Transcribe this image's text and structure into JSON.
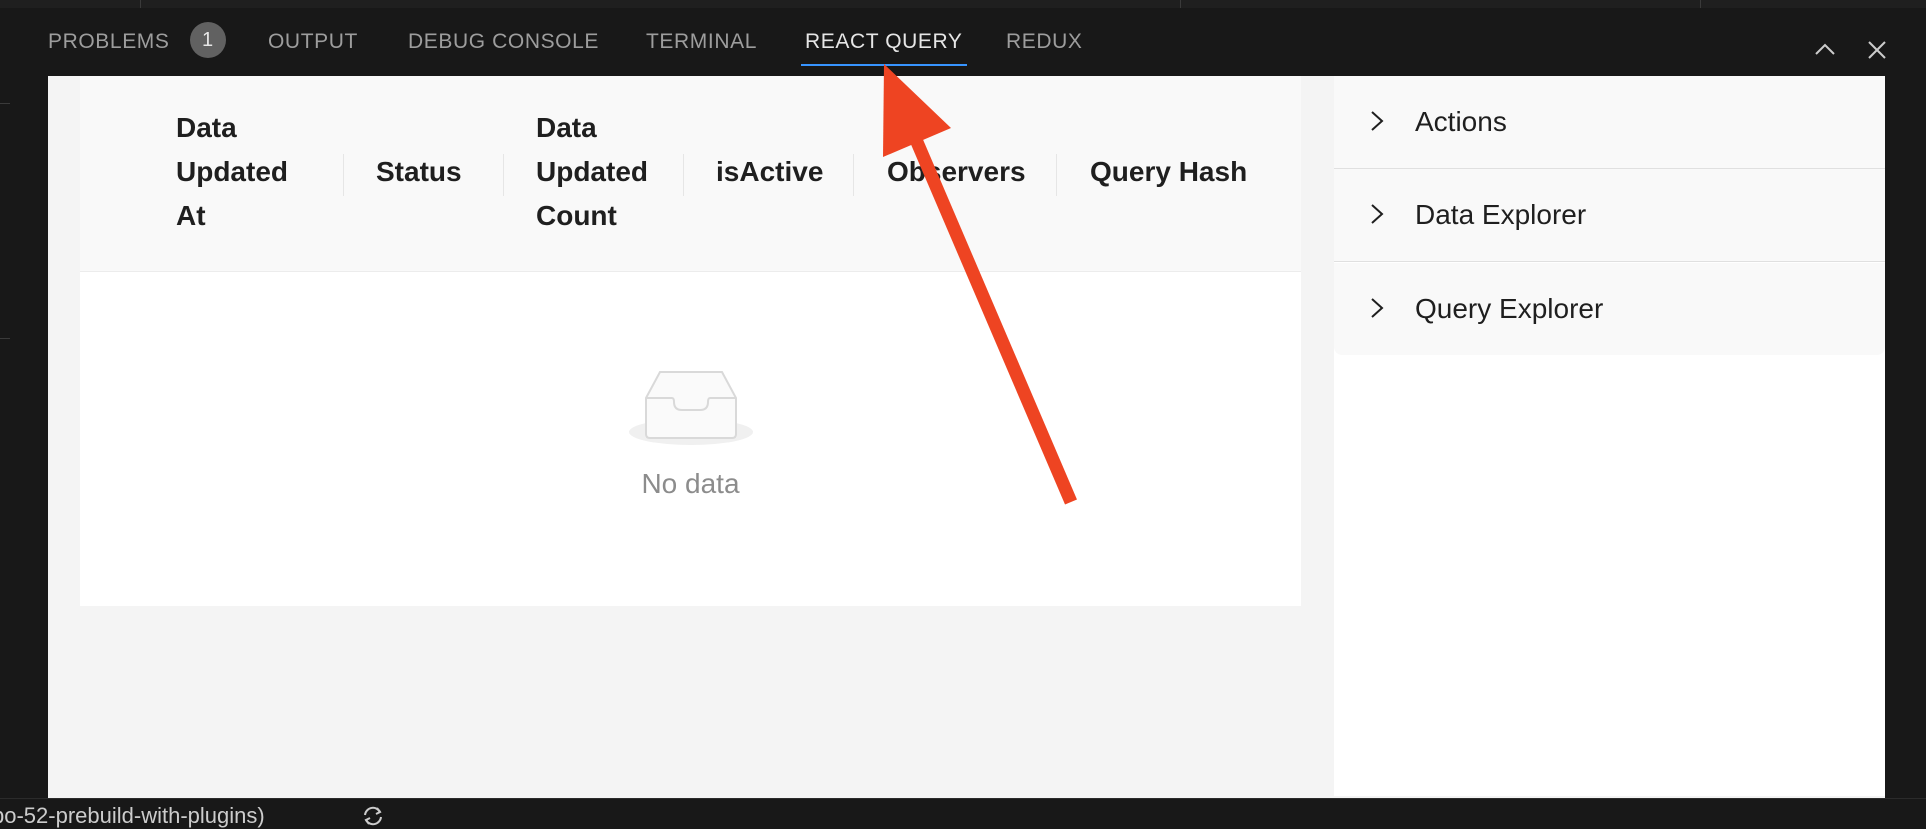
{
  "panel": {
    "tabs": [
      {
        "label": "PROBLEMS",
        "badge": "1"
      },
      {
        "label": "OUTPUT"
      },
      {
        "label": "DEBUG CONSOLE"
      },
      {
        "label": "TERMINAL"
      },
      {
        "label": "REACT QUERY",
        "active": true
      },
      {
        "label": "REDUX"
      }
    ],
    "actions": [
      "chevron-up-icon",
      "close-icon"
    ]
  },
  "table": {
    "headers": [
      {
        "lines": [
          "Data",
          "Updated",
          "At"
        ]
      },
      {
        "lines": [
          "Status"
        ]
      },
      {
        "lines": [
          "Data",
          "Updated",
          "Count"
        ]
      },
      {
        "lines": [
          "isActive"
        ]
      },
      {
        "lines": [
          "Observers"
        ]
      },
      {
        "lines": [
          "Query Hash"
        ]
      }
    ],
    "empty_text": "No data",
    "empty_icon": "inbox-icon"
  },
  "sidebar": {
    "items": [
      {
        "label": "Actions",
        "icon": "chevron-right-icon"
      },
      {
        "label": "Data Explorer",
        "icon": "chevron-right-icon"
      },
      {
        "label": "Query Explorer",
        "icon": "chevron-right-icon"
      }
    ]
  },
  "annotation": {
    "color": "#ee4422",
    "icon": "arrow-pointer"
  },
  "statusbar": {
    "branch": "po-52-prebuild-with-plugins)",
    "sync_icon": "sync-icon"
  },
  "colors": {
    "active_tab_underline": "#3794ff",
    "panel_bg": "#181818",
    "badge_bg": "#616161"
  }
}
